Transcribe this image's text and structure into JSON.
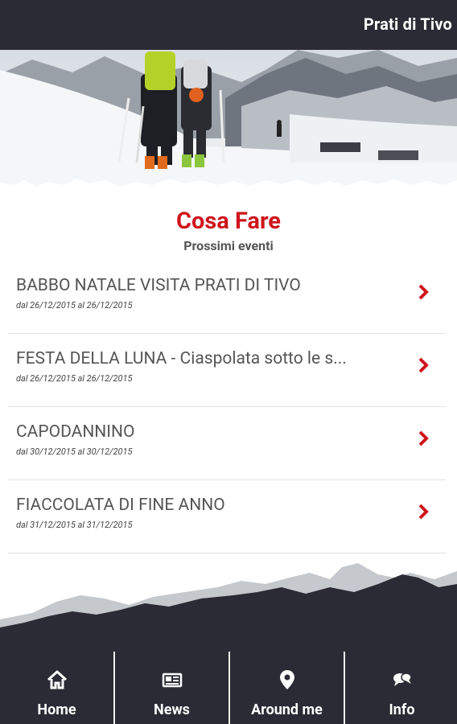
{
  "header": {
    "title": "Prati di Tivo"
  },
  "section": {
    "title": "Cosa Fare",
    "subtitle": "Prossimi eventi"
  },
  "events": [
    {
      "title": "BABBO NATALE VISITA PRATI DI TIVO",
      "date": "dal 26/12/2015 al 26/12/2015"
    },
    {
      "title": "FESTA DELLA LUNA - Ciaspolata sotto le s...",
      "date": "dal 26/12/2015 al 26/12/2015"
    },
    {
      "title": "CAPODANNINO",
      "date": "dal 30/12/2015 al 30/12/2015"
    },
    {
      "title": "FIACCOLATA DI FINE ANNO",
      "date": "dal 31/12/2015 al 31/12/2015"
    }
  ],
  "tabs": [
    {
      "label": "Home",
      "icon": "home-icon"
    },
    {
      "label": "News",
      "icon": "newspaper-icon"
    },
    {
      "label": "Around me",
      "icon": "map-pin-icon"
    },
    {
      "label": "Info",
      "icon": "chat-bubbles-icon"
    }
  ],
  "colors": {
    "accent": "#d0141c",
    "bar": "#2b2b35",
    "text": "#555555"
  }
}
